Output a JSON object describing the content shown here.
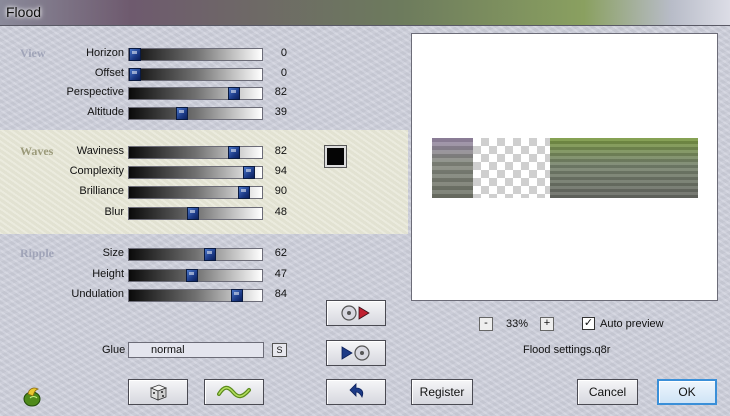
{
  "window": {
    "title": "Flood"
  },
  "sections": {
    "view": {
      "title": "View",
      "rows": [
        {
          "label": "Horizon",
          "value": 0
        },
        {
          "label": "Offset",
          "value": 0
        },
        {
          "label": "Perspective",
          "value": 82
        },
        {
          "label": "Altitude",
          "value": 39
        }
      ]
    },
    "waves": {
      "title": "Waves",
      "rows": [
        {
          "label": "Waviness",
          "value": 82
        },
        {
          "label": "Complexity",
          "value": 94
        },
        {
          "label": "Brilliance",
          "value": 90
        },
        {
          "label": "Blur",
          "value": 48
        }
      ]
    },
    "ripple": {
      "title": "Ripple",
      "rows": [
        {
          "label": "Size",
          "value": 62
        },
        {
          "label": "Height",
          "value": 47
        },
        {
          "label": "Undulation",
          "value": 84
        }
      ]
    }
  },
  "glue": {
    "label": "Glue",
    "value": "normal",
    "button_label": "S"
  },
  "color_swatch": "#050505",
  "zoom": {
    "minus": "-",
    "value": "33%",
    "plus": "+"
  },
  "auto_preview": {
    "label": "Auto preview",
    "checked": true,
    "mark": "✓"
  },
  "settings_file": "Flood settings.q8r",
  "buttons": {
    "register": "Register",
    "cancel": "Cancel",
    "ok": "OK"
  },
  "icons": {
    "app": "flame-leaf-icon",
    "random": "dice-icon",
    "wave": "wave-icon",
    "load": "load-preset-icon",
    "save": "save-preset-icon",
    "reset": "reset-icon"
  }
}
